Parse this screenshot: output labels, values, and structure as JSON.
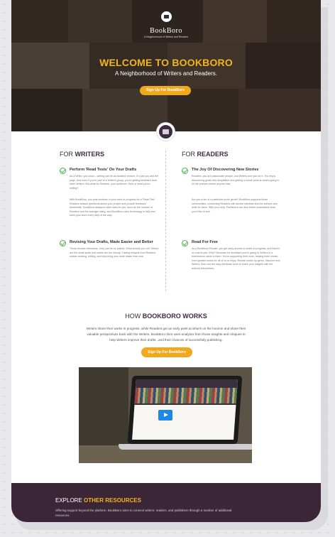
{
  "brand": {
    "name": "BookBoro",
    "tagline": "A Neighborhood of Writers and Readers"
  },
  "hero": {
    "title": "WELCOME TO BOOKBORO",
    "subtitle": "A Neighborhood of Writers and Readers.",
    "cta": "Sign Up For BookBoro"
  },
  "writers": {
    "heading_prefix": "FOR ",
    "heading_bold": "WRITERS",
    "items": [
      {
        "title": "Perform 'Read Tests' On Your Drafts",
        "body": "As a Writer, you know – writing can be an isolated venture. It's just you and the page. And even if you're part of a Writer's group, you're getting feedback from other Writers. But what do Readers, your audience, think of what you're writing?",
        "body2": "With BookBoro, you post sections of your work-in-progress for a 'Read Test.' Readers answer questions about your project and provide feedback. Meanwhile, BookBoro analyzes other data for you, such as the number of Readers and the average rating, and BookBoro uses technology to tally and track your work every step of the way."
      },
      {
        "title": "Revising Your Drafts, Made Easier and Better",
        "body": "Those revision decisions...they can be so painful. What should you cut? Where are the weak spots and where are the strong? Having insights from Readers makes revising, editing, and improving your work easier than ever."
      }
    ]
  },
  "readers": {
    "heading_prefix": "FOR ",
    "heading_bold": "READERS",
    "items": [
      {
        "title": "The Joy Of Discovering New Stories",
        "body": "Readers, you are passionate people, and Writers love you for it. You enjoy discovering great new storytellers and getting a sneak peek at what's going to hit the shelves before anyone else.",
        "body2": "Are you a fan of a particular niche genre? BookBoro supports those communities, connecting Readers with similar interests and the authors who write for them. With your help, Publishers can also better understand what you'd like to see."
      },
      {
        "title": "Read For Free",
        "body": "As a BookBoro Reader, you get early access to works in progress, and there's no cost to you. Why? Because the feedback you're giving to Writers is a tremendous value to them. You're supporting their work, helping them create even greater works for all of us to enjoy. Browse works by genre, discover new Writers, then use the easy feedback tools to share your insights with the authors themselves."
      }
    ]
  },
  "how": {
    "title_prefix": "HOW ",
    "title_bold": "BOOKBORO WORKS",
    "text": "Writers share their works in progress, while Readers get an early peek at what's on the horizon and share their valuable perspectives back with the Writers. BookBoro then uses analytics from those insights and critiques to help Writers improve their drafts...and their chances of successfully publishing.",
    "cta": "Sign Up For BookBoro"
  },
  "explore": {
    "title_prefix": "EXPLORE ",
    "title_bold": "OTHER RESOURCES",
    "text": "Offering support beyond the platform, BookBoro aims to connect writers, readers, and publishers through a number of additional resources."
  },
  "colors": {
    "accent": "#f2a81d",
    "brand_dark": "#3d2b3f",
    "check_green": "#4caf50"
  },
  "icons": {
    "logo": "book-logo-icon",
    "check": "check-circle-icon",
    "video_play": "play-icon"
  }
}
